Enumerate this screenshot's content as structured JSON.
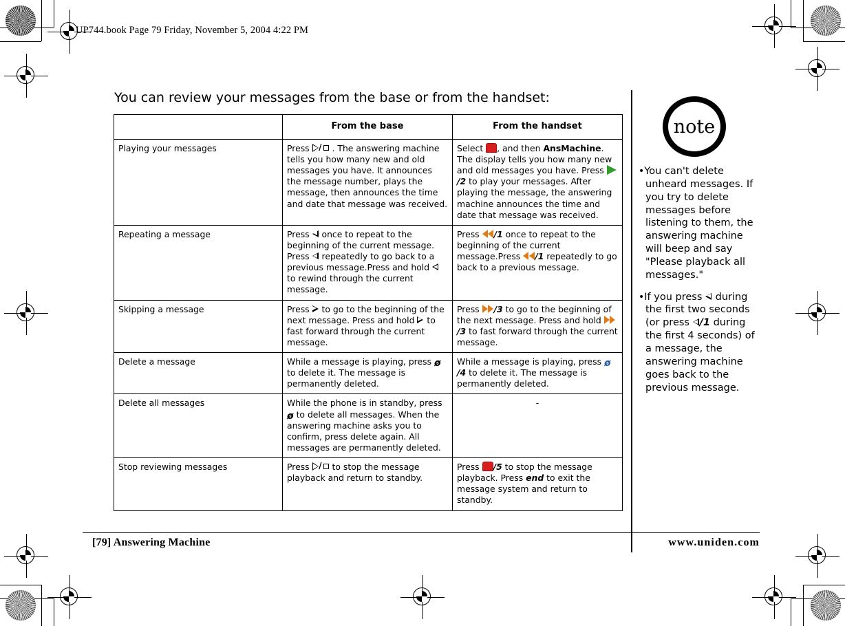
{
  "file_header": "UP744.book  Page 79  Friday, November 5, 2004  4:22 PM",
  "lede": "You can review your messages from the base or from the handset:",
  "table": {
    "headers": [
      "",
      "From the base",
      "From the handset"
    ],
    "rows": [
      {
        "label": "Playing your messages",
        "base": "Press [play-stop-icon] . The answering machine tells you how many new and old messages you have. It announces the message number, plays the message, then announces the time and date that message was received.",
        "handset": "Select [red-stop-icon] , and then AnsMachine. The display tells you how many new and old messages you have. Press [green-play-icon]/2 to play your messages. After playing the message, the answering machine announces the time and date that message was received."
      },
      {
        "label": "Repeating a message",
        "base": "Press [left-triangle-icon] once to repeat to the beginning of the current message. Press [left-triangle-icon] repeatedly to go back to a previous message.Press and hold [left-triangle-icon] to rewind through the current message.",
        "handset": "Press [rewind-icon]/1 once to repeat to the beginning of the current message.Press [rewind-icon]/1 repeatedly to go back to a previous message."
      },
      {
        "label": "Skipping a message",
        "base": "Press [right-triangle-icon] to go to the beginning of the next message. Press and hold [right-triangle-icon] to fast forward through the current message.",
        "handset": "Press [fast-forward-icon]/3 to go to the beginning of the next message. Press and hold [fast-forward-icon]/3 to fast forward through the current message."
      },
      {
        "label": "Delete a message",
        "base": "While a message is playing, press [delete-icon] to delete it. The message is permanently deleted.",
        "handset": "While a message is playing, press [delete-icon-blue]/4 to delete it. The message is permanently deleted."
      },
      {
        "label": "Delete all messages",
        "base": "While the phone is in standby, press [delete-icon] to delete all messages. When the answering machine asks you to confirm, press delete again. All messages are permanently deleted.",
        "handset": "-"
      },
      {
        "label": "Stop reviewing messages",
        "base": "Press [play-stop-icon] to stop the message playback and return to standby.",
        "handset": "Press [red-stop-icon]/5 to stop the message playback. Press end to exit the message system and return to standby."
      }
    ]
  },
  "cells": {
    "r0_base_1": "Press ",
    "r0_base_2": " . The answering machine tells you how many new and old messages you have. It announces the message number, plays the message, then announces the time and date that message was received.",
    "r0_hand_1": "Select ",
    "r0_hand_2": ", and then ",
    "r0_hand_bold": "AnsMachine",
    "r0_hand_3": ". The display tells you how many new and old messages you have. Press ",
    "r0_hand_key": "/2",
    "r0_hand_4": " to play your messages. After playing the message, the answering machine announces the time and date that message was received.",
    "r1_base_1": "Press ",
    "r1_base_2": " once to repeat to the beginning of the current message. Press ",
    "r1_base_3": " repeatedly to go back to a previous message.Press and hold ",
    "r1_base_4": " to rewind through the current message.",
    "r1_hand_1": "Press ",
    "r1_hand_k1": "/1",
    "r1_hand_2": " once to repeat to the beginning of the current message.Press ",
    "r1_hand_k2": "/1",
    "r1_hand_3": " repeatedly to go back to a previous message.",
    "r2_base_1": "Press ",
    "r2_base_2": " to go to the beginning of the next message. Press and hold ",
    "r2_base_3": " to fast forward through the current message.",
    "r2_hand_1": "Press ",
    "r2_hand_k1": "/3",
    "r2_hand_2": " to go to the beginning of the next message. Press and hold ",
    "r2_hand_k2": "/3",
    "r2_hand_3": " to fast forward through the current message.",
    "r3_base_1": "While a message is playing, press ",
    "r3_base_2": " to delete it. The message is permanently deleted.",
    "r3_hand_1": "While a message is playing, press ",
    "r3_hand_k1": "/4",
    "r3_hand_2": " to delete it. The message is permanently deleted.",
    "r4_base_1": "While the phone is in standby, press ",
    "r4_base_2": " to delete all messages. When the answering machine asks you to confirm, press delete again. All messages are permanently deleted.",
    "r4_hand": "-",
    "r5_base_1": "Press ",
    "r5_base_2": " to stop the message playback and return to standby.",
    "r5_hand_1": "Press ",
    "r5_hand_k1": "/5",
    "r5_hand_2": " to stop the message playback. Press ",
    "r5_hand_end": "end",
    "r5_hand_3": " to exit the message system and return to standby.",
    "delete_glyph": "ø",
    "slash": "/"
  },
  "note": {
    "badge": "note",
    "bullets": [
      "You can't delete unheard messages. If you try to delete messages before listening to them, the answering machine will beep and say \"Please playback all messages.\"",
      "If you press [left-triangle-icon] during the first two seconds (or press [left-triangle-icon]/1 during the first 4 seconds) of a message, the answering machine goes back to the previous message."
    ],
    "b1": "You can't delete unheard messages. If you try to delete messages before listening to them, the answering machine will beep and say \"Please playback all messages.\"",
    "b2_1": "If you press ",
    "b2_2": " during the first two seconds (or press ",
    "b2_k": "/1",
    "b2_3": " during the first 4 seconds) of a message, the answering machine goes back to the previous message.",
    "bullet_char": "•"
  },
  "footer": {
    "left": "[79] Answering Machine",
    "right": "www.uniden.com"
  },
  "colors": {
    "red": "#d81f1f",
    "green": "#2f9e2f",
    "orange": "#e07b18",
    "blue": "#2a5fa8"
  }
}
